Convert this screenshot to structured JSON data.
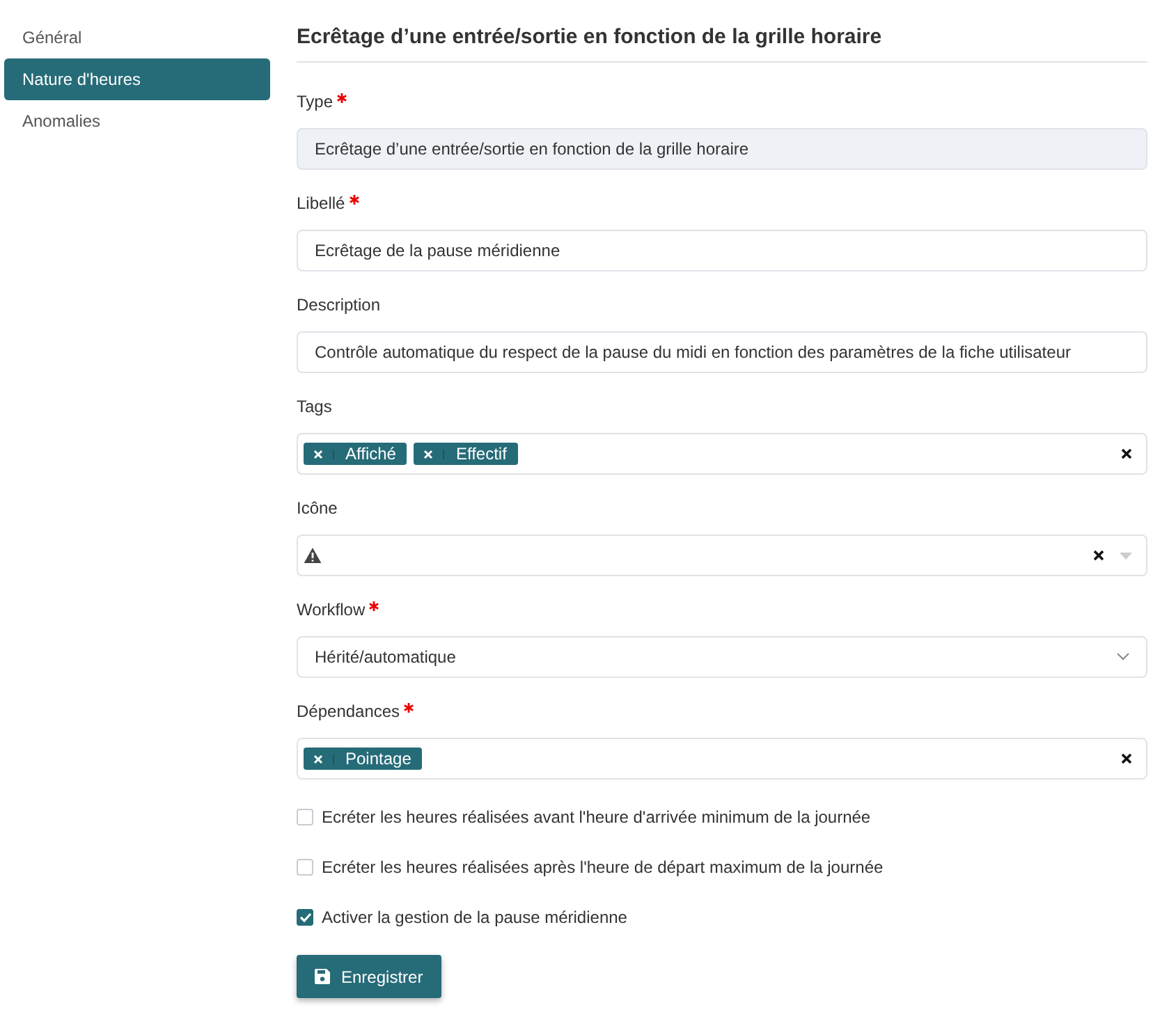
{
  "sidebar": {
    "items": [
      {
        "label": "Général",
        "selected": false
      },
      {
        "label": "Nature d'heures",
        "selected": true
      },
      {
        "label": "Anomalies",
        "selected": false
      }
    ]
  },
  "section_title": "Ecrêtage d’une entrée/sortie en fonction de la grille horaire",
  "fields": [
    {
      "kind": "readonly",
      "label": "Type",
      "required": true,
      "value": "Ecrêtage d’une entrée/sortie en fonction de la grille horaire"
    },
    {
      "kind": "text",
      "label": "Libellé",
      "required": true,
      "value": "Ecrêtage de la pause méridienne"
    },
    {
      "kind": "text",
      "label": "Description",
      "required": false,
      "value": "Contrôle automatique du respect de la pause du midi en fonction des paramètres de la fiche utilisateur"
    },
    {
      "kind": "tags",
      "label": "Tags",
      "required": false,
      "tags": [
        "Affiché",
        "Effectif"
      ]
    },
    {
      "kind": "icon",
      "label": "Icône",
      "required": false
    },
    {
      "kind": "select",
      "label": "Workflow",
      "required": true,
      "value": "Hérité/automatique"
    },
    {
      "kind": "tags",
      "label": "Dépendances",
      "required": true,
      "tags": [
        "Pointage"
      ]
    }
  ],
  "checkboxes": [
    {
      "label": "Ecréter les heures réalisées avant l'heure d'arrivée minimum de la journée",
      "checked": false
    },
    {
      "label": "Ecréter les heures réalisées après l'heure de départ maximum de la journée",
      "checked": false
    },
    {
      "label": "Activer la gestion de la pause méridienne",
      "checked": true
    }
  ],
  "save_button": "Enregistrer"
}
